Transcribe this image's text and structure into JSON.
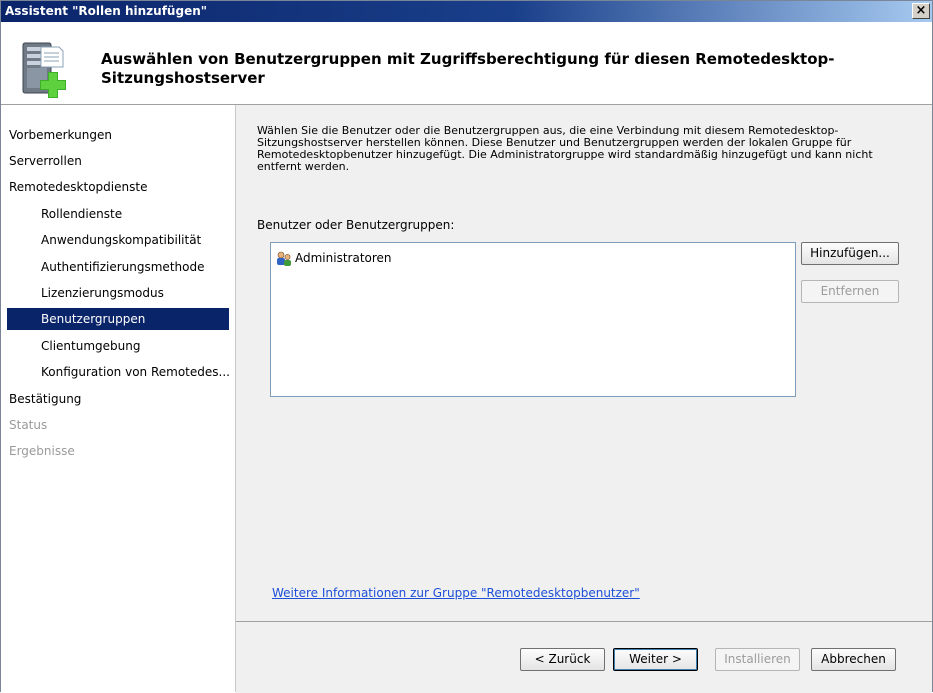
{
  "window": {
    "title": "Assistent \"Rollen hinzufügen\"",
    "close_label": "×"
  },
  "header": {
    "title": "Auswählen von Benutzergruppen mit Zugriffsberechtigung für diesen Remotedesktop-Sitzungshostserver",
    "icon": "server-add-icon"
  },
  "sidebar": {
    "items": [
      {
        "label": "Vorbemerkungen",
        "level": 1,
        "state": "normal"
      },
      {
        "label": "Serverrollen",
        "level": 1,
        "state": "normal"
      },
      {
        "label": "Remotedesktopdienste",
        "level": 1,
        "state": "normal"
      },
      {
        "label": "Rollendienste",
        "level": 2,
        "state": "normal"
      },
      {
        "label": "Anwendungskompatibilität",
        "level": 2,
        "state": "normal"
      },
      {
        "label": "Authentifizierungsmethode",
        "level": 2,
        "state": "normal"
      },
      {
        "label": "Lizenzierungsmodus",
        "level": 2,
        "state": "normal"
      },
      {
        "label": "Benutzergruppen",
        "level": 2,
        "state": "selected"
      },
      {
        "label": "Clientumgebung",
        "level": 2,
        "state": "normal"
      },
      {
        "label": "Konfiguration von Remotedes...",
        "level": 2,
        "state": "normal"
      },
      {
        "label": "Bestätigung",
        "level": 1,
        "state": "normal"
      },
      {
        "label": "Status",
        "level": 1,
        "state": "disabled"
      },
      {
        "label": "Ergebnisse",
        "level": 1,
        "state": "disabled"
      }
    ]
  },
  "main": {
    "description": "Wählen Sie die Benutzer oder die Benutzergruppen aus, die eine Verbindung mit diesem Remotedesktop-Sitzungshostserver herstellen können. Diese Benutzer und Benutzergruppen werden der lokalen Gruppe für Remotedesktopbenutzer hinzugefügt. Die Administratorgruppe wird standardmäßig hinzugefügt und kann nicht entfernt werden.",
    "list_label": "Benutzer oder Benutzergruppen:",
    "list_items": [
      {
        "label": "Administratoren",
        "icon": "user-group-icon"
      }
    ],
    "add_button": "Hinzufügen...",
    "remove_button": "Entfernen",
    "info_link": "Weitere Informationen zur Gruppe \"Remotedesktopbenutzer\""
  },
  "footer": {
    "back_button": "< Zurück",
    "next_button": "Weiter >",
    "install_button": "Installieren",
    "cancel_button": "Abbrechen"
  },
  "colors": {
    "selection": "#0a246a",
    "link": "#1d4fd7",
    "titlebar_start": "#0a246a",
    "titlebar_end": "#a6caf0"
  }
}
